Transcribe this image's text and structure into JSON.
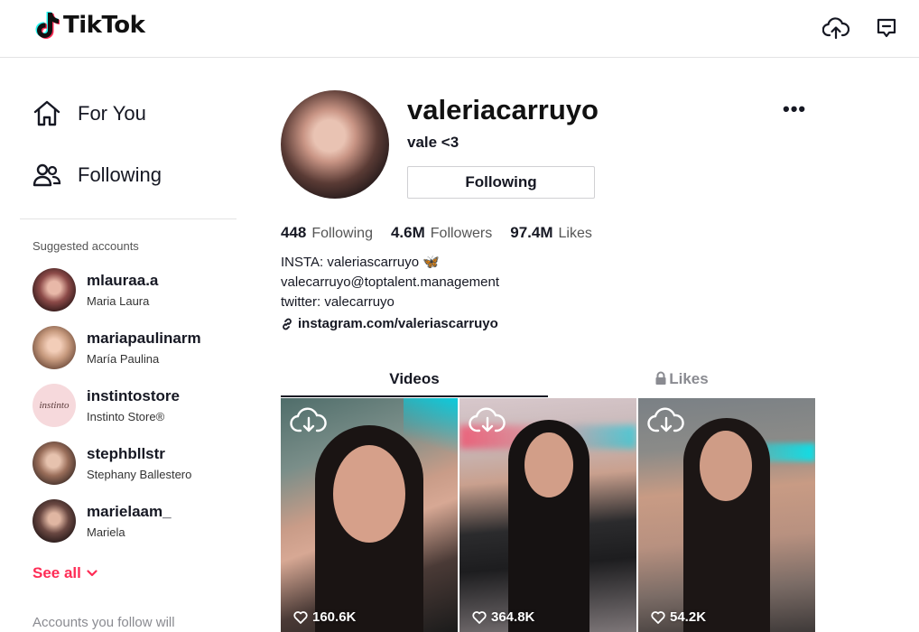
{
  "topbar": {
    "logo_text": "TikTok",
    "upload_icon": "cloud-upload-icon",
    "messages_icon": "inbox-message-icon"
  },
  "sidebar": {
    "nav": [
      {
        "label": "For You",
        "icon": "home-icon"
      },
      {
        "label": "Following",
        "icon": "people-icon"
      }
    ],
    "suggested_title": "Suggested accounts",
    "accounts": [
      {
        "username": "mlauraa.a",
        "name": "Maria Laura",
        "avatar_color": "#6b3a3a"
      },
      {
        "username": "mariapaulinarm",
        "name": "María Paulina",
        "avatar_color": "#b98a6e"
      },
      {
        "username": "instintostore",
        "name": "Instinto Store®",
        "avatar_color": "#f6d9dc",
        "avatar_text": "instinto"
      },
      {
        "username": "stephbllstr",
        "name": "Stephany Ballestero",
        "avatar_color": "#7a5a4a"
      },
      {
        "username": "marielaam_",
        "name": "Mariela",
        "avatar_color": "#4a3430"
      }
    ],
    "see_all": "See all",
    "footer_note": "Accounts you follow will"
  },
  "profile": {
    "username": "valeriacarruyo",
    "nickname": "vale <3",
    "follow_button": "Following",
    "more": "•••",
    "stats": [
      {
        "value": "448",
        "label": "Following"
      },
      {
        "value": "4.6M",
        "label": "Followers"
      },
      {
        "value": "97.4M",
        "label": "Likes"
      }
    ],
    "bio": [
      "INSTA: valeriascarruyo 🦋",
      "valecarruyo@toptalent.management",
      "twitter: valecarruyo"
    ],
    "link": "instagram.com/valeriascarruyo"
  },
  "tabs": [
    {
      "label": "Videos",
      "active": true
    },
    {
      "label": "Likes",
      "active": false,
      "icon": "lock-icon"
    }
  ],
  "videos": [
    {
      "likes": "160.6K"
    },
    {
      "likes": "364.8K"
    },
    {
      "likes": "54.2K"
    }
  ],
  "colors": {
    "accent": "#fe2c55",
    "text": "#161823",
    "muted": "#8a8b91"
  }
}
